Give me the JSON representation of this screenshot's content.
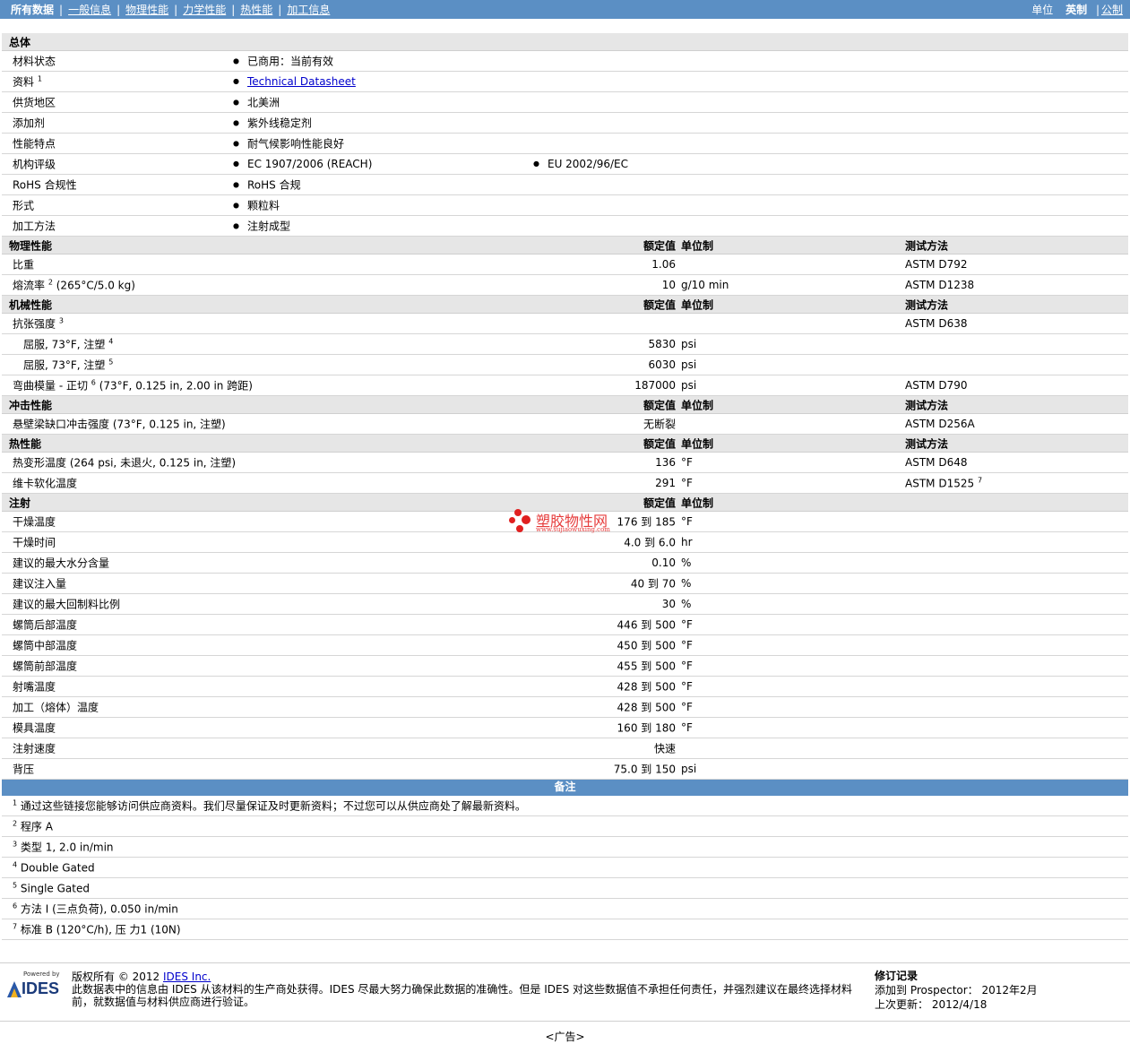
{
  "nav": {
    "tabs": [
      "所有数据",
      "一般信息",
      "物理性能",
      "力学性能",
      "热性能",
      "加工信息"
    ],
    "active_index": 0,
    "units_label": "单位",
    "units": [
      "英制",
      "公制"
    ],
    "units_selected": 0,
    "separator": "|"
  },
  "headers": {
    "value": "额定值",
    "unit": "单位制",
    "test": "测试方法"
  },
  "general": {
    "title": "总体",
    "rows": [
      {
        "label": "材料状态",
        "items": [
          "已商用：当前有效"
        ]
      },
      {
        "label": "资料",
        "sup": "1",
        "link": "Technical Datasheet"
      },
      {
        "label": "供货地区",
        "items": [
          "北美洲"
        ]
      },
      {
        "label": "添加剂",
        "items": [
          "紫外线稳定剂"
        ]
      },
      {
        "label": "性能特点",
        "items": [
          "耐气候影响性能良好"
        ]
      },
      {
        "label": "机构评级",
        "items": [
          "EC 1907/2006 (REACH)",
          "EU 2002/96/EC"
        ]
      },
      {
        "label": "RoHS 合规性",
        "items": [
          "RoHS 合规"
        ]
      },
      {
        "label": "形式",
        "items": [
          "颗粒料"
        ]
      },
      {
        "label": "加工方法",
        "items": [
          "注射成型"
        ]
      }
    ]
  },
  "sections": [
    {
      "title": "物理性能",
      "show_test": true,
      "rows": [
        {
          "label": "比重",
          "value": "1.06",
          "unit": "",
          "test": "ASTM D792"
        },
        {
          "label": "熔流率",
          "sup": "2",
          "cond": " (265°C/5.0 kg)",
          "value": "10",
          "unit": "g/10 min",
          "test": "ASTM D1238"
        }
      ]
    },
    {
      "title": "机械性能",
      "show_test": true,
      "rows": [
        {
          "label": "抗张强度",
          "sup": "3",
          "value": "",
          "unit": "",
          "test": "ASTM D638"
        },
        {
          "label": "屈服, 73°F, 注塑",
          "sup": "4",
          "indent": true,
          "value": "5830",
          "unit": "psi",
          "test": ""
        },
        {
          "label": "屈服, 73°F, 注塑",
          "sup": "5",
          "indent": true,
          "value": "6030",
          "unit": "psi",
          "test": ""
        },
        {
          "label": "弯曲模量 - 正切",
          "sup": "6",
          "cond": " (73°F, 0.125 in, 2.00 in 跨距)",
          "value": "187000",
          "unit": "psi",
          "test": "ASTM D790"
        }
      ]
    },
    {
      "title": "冲击性能",
      "show_test": true,
      "rows": [
        {
          "label": "悬壁梁缺口冲击强度",
          "cond": " (73°F, 0.125 in, 注塑)",
          "value": "无断裂",
          "unit": "",
          "test": "ASTM D256A"
        }
      ]
    },
    {
      "title": "热性能",
      "show_test": true,
      "rows": [
        {
          "label": "热变形温度",
          "cond": " (264 psi, 未退火, 0.125 in, 注塑)",
          "value": "136",
          "unit": "°F",
          "test": "ASTM D648"
        },
        {
          "label": "维卡软化温度",
          "value": "291",
          "unit": "°F",
          "test": "ASTM D1525",
          "test_sup": "7"
        }
      ]
    },
    {
      "title": "注射",
      "show_test": false,
      "rows": [
        {
          "label": "干燥温度",
          "value": "176 到  185",
          "unit": "°F",
          "test": ""
        },
        {
          "label": "干燥时间",
          "value": "4.0 到  6.0",
          "unit": "hr",
          "test": ""
        },
        {
          "label": "建议的最大水分含量",
          "value": "0.10",
          "unit": "%",
          "test": ""
        },
        {
          "label": "建议注入量",
          "value": "40 到  70",
          "unit": "%",
          "test": ""
        },
        {
          "label": "建议的最大回制料比例",
          "value": "30",
          "unit": "%",
          "test": ""
        },
        {
          "label": "螺筒后部温度",
          "value": "446 到  500",
          "unit": "°F",
          "test": ""
        },
        {
          "label": "螺筒中部温度",
          "value": "450 到  500",
          "unit": "°F",
          "test": ""
        },
        {
          "label": "螺筒前部温度",
          "value": "455 到  500",
          "unit": "°F",
          "test": ""
        },
        {
          "label": "射嘴温度",
          "value": "428 到  500",
          "unit": "°F",
          "test": ""
        },
        {
          "label": "加工（熔体）温度",
          "value": "428 到  500",
          "unit": "°F",
          "test": ""
        },
        {
          "label": "模具温度",
          "value": "160 到  180",
          "unit": "°F",
          "test": ""
        },
        {
          "label": "注射速度",
          "value": "快速",
          "unit": "",
          "test": ""
        },
        {
          "label": "背压",
          "value": "75.0 到  150",
          "unit": "psi",
          "test": ""
        }
      ]
    }
  ],
  "notes": {
    "title": "备注",
    "items": [
      {
        "n": "1",
        "text": "通过这些链接您能够访问供应商资料。我们尽量保证及时更新资料；不过您可以从供应商处了解最新资料。"
      },
      {
        "n": "2",
        "text": "程序  A"
      },
      {
        "n": "3",
        "text": "类型  1, 2.0 in/min"
      },
      {
        "n": "4",
        "text": "Double Gated"
      },
      {
        "n": "5",
        "text": "Single Gated"
      },
      {
        "n": "6",
        "text": "方法  I (三点负荷), 0.050 in/min"
      },
      {
        "n": "7",
        "text": "标准  B (120°C/h), 压  力1 (10N)"
      }
    ]
  },
  "footer": {
    "logo_powered": "Powered by",
    "logo_name": "IDES",
    "copyright_prefix": "版权所有  © 2012 ",
    "copyright_link": "IDES Inc.",
    "disclaimer": "此数据表中的信息由  IDES 从该材料的生产商处获得。IDES 尽最大努力确保此数据的准确性。但是  IDES 对这些数据值不承担任何责任，并强烈建议在最终选择材料前，就数据值与材料供应商进行验证。",
    "rev_title": "修订记录",
    "rev_added": "添加到  Prospector：  2012年2月",
    "rev_updated": "上次更新：  2012/4/18",
    "ad": "<广告>"
  },
  "watermark": {
    "name": "塑胶物性网",
    "url": "www.sujiaowuxing.com"
  }
}
